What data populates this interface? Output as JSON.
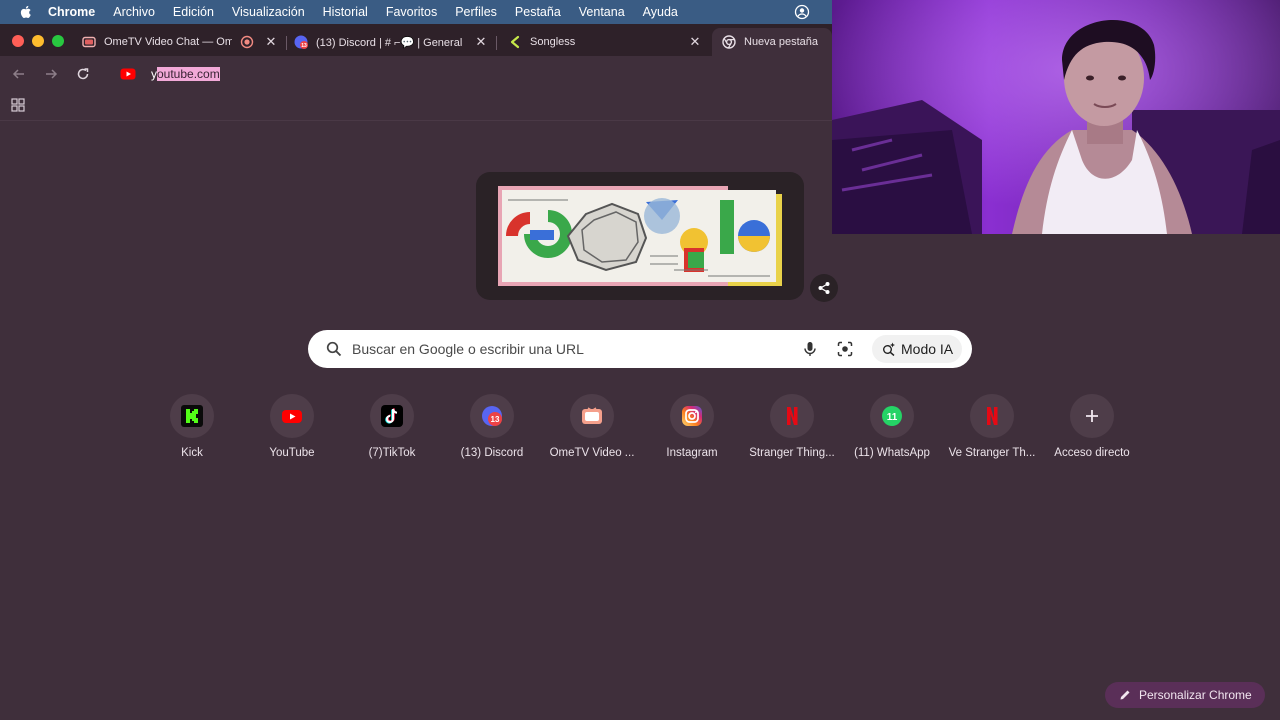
{
  "menubar": {
    "app_name": "Chrome",
    "items": [
      "Archivo",
      "Edición",
      "Visualización",
      "Historial",
      "Favoritos",
      "Perfiles",
      "Pestaña",
      "Ventana",
      "Ayuda"
    ]
  },
  "tabs": [
    {
      "title": "OmeTV Video Chat — Om",
      "icon": "ometv-tab-icon",
      "recording": true
    },
    {
      "title": "(13) Discord | # ⌐💬 | General",
      "icon": "discord-tab-icon"
    },
    {
      "title": "Songless",
      "icon": "songless-tab-icon"
    },
    {
      "title": "Nueva pestaña",
      "icon": "chrome-tab-icon",
      "active": true
    }
  ],
  "omnibox": {
    "first_char": "y",
    "selected_text": "outube.com",
    "favicon": "youtube-icon"
  },
  "search": {
    "placeholder": "Buscar en Google o escribir una URL",
    "ai_mode_label": "Modo IA"
  },
  "shortcuts": [
    {
      "label": "Kick",
      "icon": "kick-icon"
    },
    {
      "label": "YouTube",
      "icon": "youtube-icon"
    },
    {
      "label": "(7)TikTok",
      "icon": "tiktok-icon"
    },
    {
      "label": "(13) Discord",
      "icon": "discord-icon"
    },
    {
      "label": "OmeTV Video ...",
      "icon": "ometv-icon"
    },
    {
      "label": "Instagram",
      "icon": "instagram-icon"
    },
    {
      "label": "Stranger Thing...",
      "icon": "netflix-icon"
    },
    {
      "label": "(11) WhatsApp",
      "icon": "whatsapp-icon"
    },
    {
      "label": "Ve Stranger Th...",
      "icon": "netflix-icon"
    },
    {
      "label": "Acceso directo",
      "icon": "plus-icon"
    }
  ],
  "badges": {
    "discord_count": "13",
    "whatsapp_count": "11"
  },
  "customize_label": "Personalizar Chrome",
  "colors": {
    "page_bg": "#3f2f3b",
    "tabstrip_bg": "#2e2129",
    "menubar_bg": "#3a5c84",
    "customize_bg": "#5a2f58",
    "selection": "#f2a9d8"
  }
}
